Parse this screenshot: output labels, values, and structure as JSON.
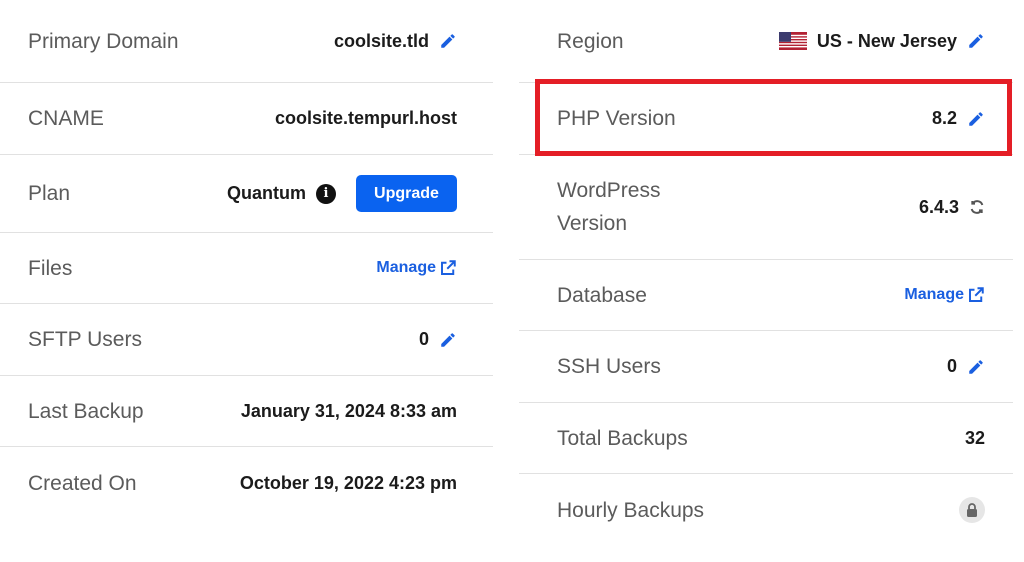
{
  "left": {
    "primary_domain": {
      "label": "Primary Domain",
      "value": "coolsite.tld"
    },
    "cname": {
      "label": "CNAME",
      "value": "coolsite.tempurl.host"
    },
    "plan": {
      "label": "Plan",
      "value": "Quantum",
      "upgrade_label": "Upgrade"
    },
    "files": {
      "label": "Files",
      "link": "Manage"
    },
    "sftp_users": {
      "label": "SFTP Users",
      "value": "0"
    },
    "last_backup": {
      "label": "Last Backup",
      "value": "January 31, 2024 8:33 am"
    },
    "created_on": {
      "label": "Created On",
      "value": "October 19, 2022 4:23 pm"
    }
  },
  "right": {
    "region": {
      "label": "Region",
      "value": "US - New Jersey",
      "flag": "us-flag-icon"
    },
    "php_version": {
      "label": "PHP Version",
      "value": "8.2"
    },
    "wordpress_version": {
      "label_line1": "WordPress",
      "label_line2": "Version",
      "value": "6.4.3"
    },
    "database": {
      "label": "Database",
      "link": "Manage"
    },
    "ssh_users": {
      "label": "SSH Users",
      "value": "0"
    },
    "total_backups": {
      "label": "Total Backups",
      "value": "32"
    },
    "hourly_backups": {
      "label": "Hourly Backups",
      "status_icon": "lock-icon"
    }
  },
  "colors": {
    "accent": "#0a63f0",
    "link": "#1a5fe0",
    "highlight": "#e41e26",
    "divider": "#e1e1e1"
  }
}
